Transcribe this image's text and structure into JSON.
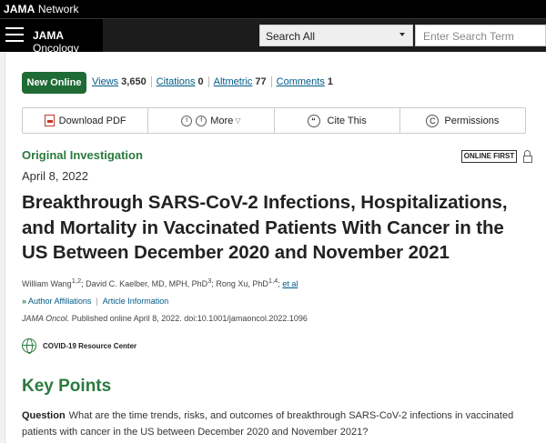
{
  "network": {
    "brand_bold": "JAMA",
    "brand_rest": " Network"
  },
  "journal": {
    "name_bold": "JAMA",
    "name_rest": " Oncology"
  },
  "search": {
    "scope": "Search All",
    "placeholder": "Enter Search Term"
  },
  "metrics": {
    "badge": "New Online",
    "items": [
      {
        "label": "Views",
        "value": "3,650"
      },
      {
        "label": "Citations",
        "value": "0"
      },
      {
        "label": "Altmetric",
        "value": "77"
      },
      {
        "label": "Comments",
        "value": "1"
      }
    ]
  },
  "toolbar": {
    "download": "Download PDF",
    "more": "More",
    "cite": "Cite This",
    "permissions": "Permissions"
  },
  "article": {
    "type": "Original Investigation",
    "status_badge": "ONLINE FIRST",
    "date": "April 8, 2022",
    "title": "Breakthrough SARS-CoV-2 Infections, Hospitalizations, and Mortality in Vaccinated Patients With Cancer in the US Between December 2020 and November 2021",
    "authors": [
      {
        "name": "William Wang",
        "sup": "1,2"
      },
      {
        "name": "David C. Kaelber, MD, MPH, PhD",
        "sup": "3"
      },
      {
        "name": "Rong Xu, PhD",
        "sup": "1,4"
      }
    ],
    "et_al": "et al",
    "affiliations_link": "Author Affiliations",
    "article_info_link": "Article Information",
    "journal_abbrev": "JAMA Oncol.",
    "citation_rest": " Published online April 8, 2022. doi:10.1001/jamaoncol.2022.1096"
  },
  "resource": {
    "label": "COVID-19 Resource Center"
  },
  "key_points": {
    "heading": "Key Points",
    "question_label": "Question",
    "question_text": "What are the time trends, risks, and outcomes of breakthrough SARS-CoV-2 infections in vaccinated patients with cancer in the US between December 2020 and November 2021?"
  }
}
